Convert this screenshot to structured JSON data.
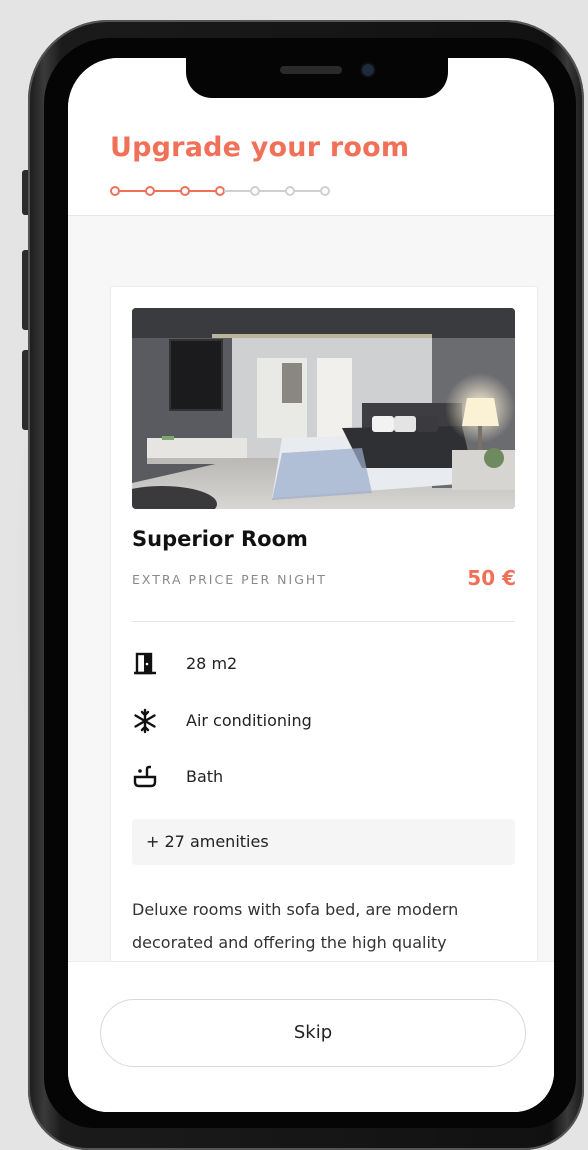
{
  "header": {
    "title": "Upgrade your room",
    "steps_total": 7,
    "steps_completed": 4
  },
  "room": {
    "name": "Superior Room",
    "price_label": "EXTRA PRICE PER NIGHT",
    "price": "50 €",
    "features": [
      {
        "icon": "door-icon",
        "label": "28 m2"
      },
      {
        "icon": "snowflake-icon",
        "label": "Air conditioning"
      },
      {
        "icon": "bathtub-icon",
        "label": "Bath"
      }
    ],
    "amenities_label": "+ 27 amenities",
    "description": "Deluxe rooms with sofa bed, are modern decorated and offering the high quality"
  },
  "footer": {
    "skip_label": "Skip"
  },
  "colors": {
    "accent": "#f07058",
    "step_inactive": "#d0d0d0"
  }
}
